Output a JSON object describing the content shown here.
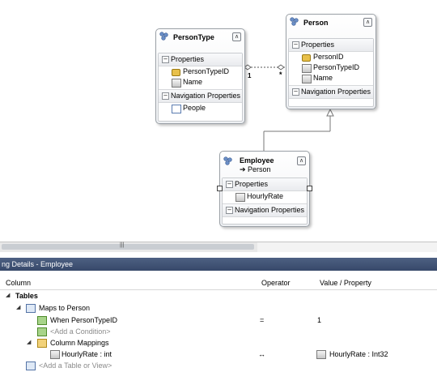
{
  "entities": {
    "person_type": {
      "name": "PersonType",
      "properties_label": "Properties",
      "properties": [
        "PersonTypeID",
        "Name"
      ],
      "nav_label": "Navigation Properties",
      "nav_properties": [
        "People"
      ]
    },
    "person": {
      "name": "Person",
      "properties_label": "Properties",
      "properties": [
        "PersonID",
        "PersonTypeID",
        "Name"
      ],
      "nav_label": "Navigation Properties"
    },
    "employee": {
      "name": "Employee",
      "base_type": "➔ Person",
      "properties_label": "Properties",
      "properties": [
        "HourlyRate"
      ],
      "nav_label": "Navigation Properties"
    }
  },
  "association": {
    "one_label": "1",
    "many_label": "*"
  },
  "scrollbar": {
    "grip": "|||"
  },
  "panel": {
    "title": "ng Details - Employee",
    "columns": {
      "column": "Column",
      "operator": "Operator",
      "value": "Value / Property"
    },
    "tables_label": "Tables",
    "maps_to": "Maps to Person",
    "condition": {
      "label": "When PersonTypeID",
      "operator": "=",
      "value": "1"
    },
    "add_condition": "<Add a Condition>",
    "column_mappings": "Column Mappings",
    "mapping": {
      "column": "HourlyRate : int",
      "operator": "↔",
      "value": "HourlyRate : Int32"
    },
    "add_table": "<Add a Table or View>"
  }
}
